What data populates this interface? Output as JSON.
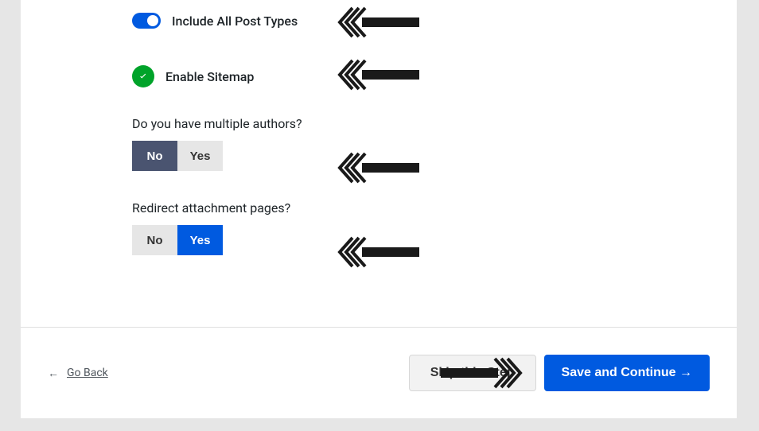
{
  "options": {
    "include_all_post_types": {
      "label": "Include All Post Types"
    },
    "enable_sitemap": {
      "label": "Enable Sitemap"
    },
    "multiple_authors": {
      "question": "Do you have multiple authors?",
      "no": "No",
      "yes": "Yes"
    },
    "redirect_attachment": {
      "question": "Redirect attachment pages?",
      "no": "No",
      "yes": "Yes"
    }
  },
  "footer": {
    "go_back_arrow": "←",
    "go_back": "Go Back",
    "skip": "Skip this Step",
    "continue": "Save and Continue →"
  }
}
